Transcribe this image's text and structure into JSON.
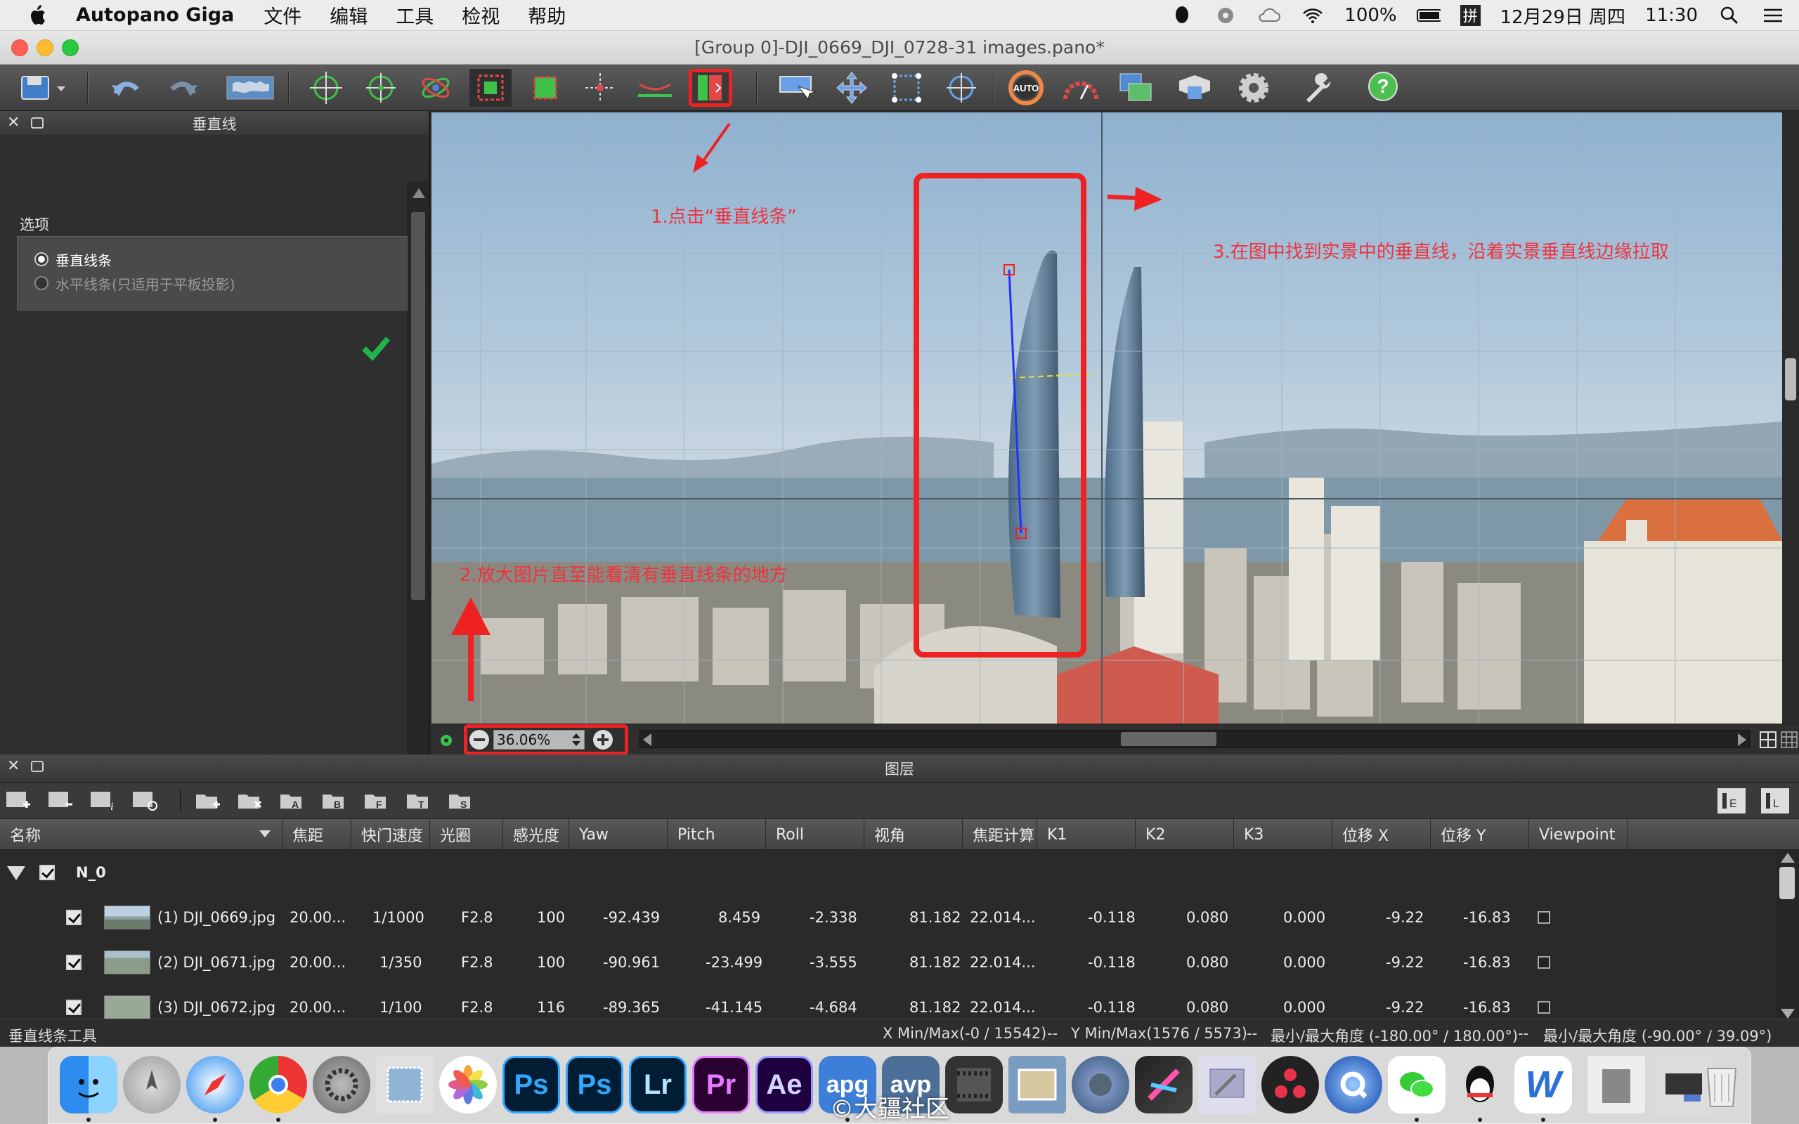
{
  "menubar": {
    "app_name": "Autopano Giga",
    "menus": [
      "文件",
      "编辑",
      "工具",
      "检视",
      "帮助"
    ],
    "battery": "100%",
    "input_method": "拼",
    "date": "12月29日 周四",
    "time": "11:30"
  },
  "window": {
    "title": "[Group 0]-DJI_0669_DJI_0728-31 images.pano*"
  },
  "left_panel": {
    "title": "垂直线",
    "options_label": "选项",
    "option_vertical": "垂直线条",
    "option_horizontal": "水平线条(只适用于平板投影)"
  },
  "canvas": {
    "zoom": "36.06%"
  },
  "annotations": {
    "step1": "1.点击“垂直线条”",
    "step2": "2.放大图片直至能看清有垂直线条的地方",
    "step3": "3.在图中找到实景中的垂直线，沿着实景垂直线边缘拉取"
  },
  "layers": {
    "title": "图层",
    "columns": [
      "名称",
      "焦距",
      "快门速度",
      "光圈",
      "感光度",
      "Yaw",
      "Pitch",
      "Roll",
      "视角",
      "焦距计算",
      "K1",
      "K2",
      "K3",
      "位移 X",
      "位移 Y",
      "Viewpoint"
    ],
    "group": "N_0",
    "rows": [
      {
        "name": "(1) DJI_0669.jpg",
        "focal": "20.00...",
        "shutter": "1/1000",
        "aperture": "F2.8",
        "iso": "100",
        "yaw": "-92.439",
        "pitch": "8.459",
        "roll": "-2.338",
        "fov": "81.182",
        "focal_calc": "22.014...",
        "k1": "-0.118",
        "k2": "0.080",
        "k3": "0.000",
        "x": "-9.22",
        "y": "-16.83"
      },
      {
        "name": "(2) DJI_0671.jpg",
        "focal": "20.00...",
        "shutter": "1/350",
        "aperture": "F2.8",
        "iso": "100",
        "yaw": "-90.961",
        "pitch": "-23.499",
        "roll": "-3.555",
        "fov": "81.182",
        "focal_calc": "22.014...",
        "k1": "-0.118",
        "k2": "0.080",
        "k3": "0.000",
        "x": "-9.22",
        "y": "-16.83"
      },
      {
        "name": "(3) DJI_0672.jpg",
        "focal": "20.00...",
        "shutter": "1/100",
        "aperture": "F2.8",
        "iso": "116",
        "yaw": "-89.365",
        "pitch": "-41.145",
        "roll": "-4.684",
        "fov": "81.182",
        "focal_calc": "22.014...",
        "k1": "-0.118",
        "k2": "0.080",
        "k3": "0.000",
        "x": "-9.22",
        "y": "-16.83"
      }
    ]
  },
  "status": {
    "tool": "垂直线条工具",
    "x_minmax": "X Min/Max(-0 / 15542)",
    "y_minmax": "Y Min/Max(1576 / 5573)",
    "h_angle": "最小/最大角度 (-180.00° / 180.00°)",
    "v_angle": "最小/最大角度 (-90.00° / 39.09°)",
    "sep": "--"
  },
  "dock": {
    "watermark": "©大疆社区",
    "apps": [
      "Ps",
      "Ps",
      "Lr",
      "Pr",
      "Ae",
      "apg",
      "avp"
    ]
  },
  "colors": {
    "annotation": "#ee3340",
    "accent_green": "#22b34a",
    "line_blue": "#2233ff"
  }
}
